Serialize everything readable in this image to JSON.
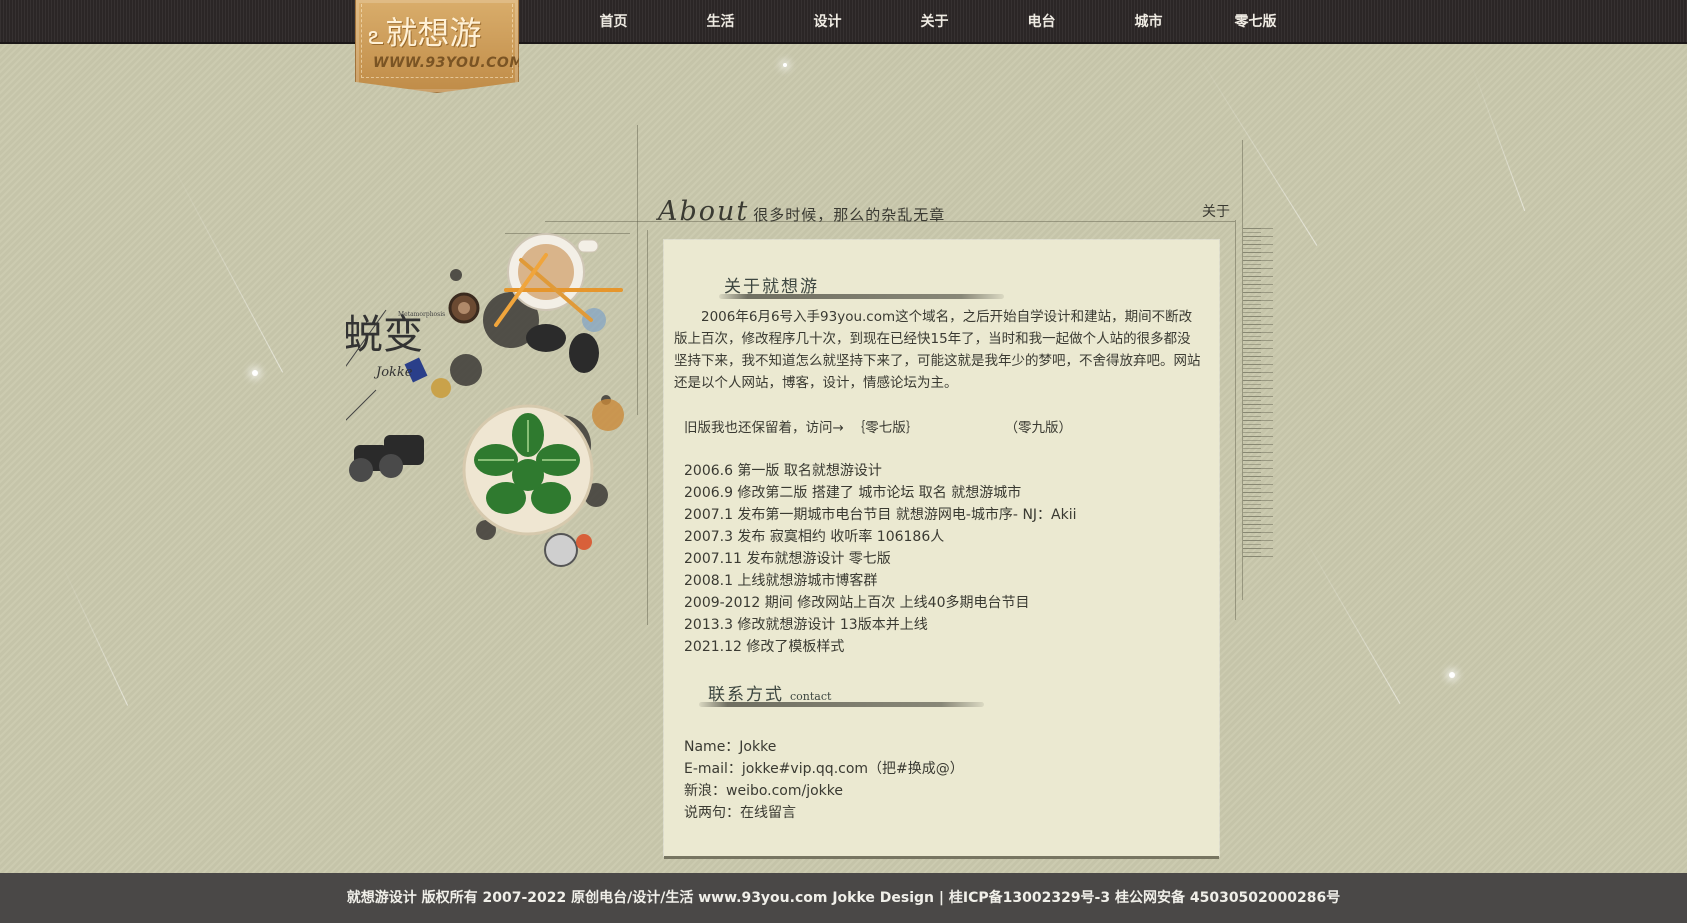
{
  "logo": {
    "name": "就想游",
    "url": "WWW.93YOU.COM"
  },
  "nav": [
    "首页",
    "生活",
    "设计",
    "关于",
    "电台",
    "城市",
    "零七版"
  ],
  "about_header": {
    "title": "About",
    "subtitle": "很多时候，那么的杂乱无章",
    "right_label": "关于"
  },
  "art": {
    "title": "蜕变",
    "subtitle": "Metamorphosis",
    "signature": "Jokke"
  },
  "intro": {
    "title": "关于就想游",
    "paragraph": "2006年6月6号入手93you.com这个域名，之后开始自学设计和建站，期间不断改版上百次，修改程序几十次，到现在已经快15年了，当时和我一起做个人站的很多都没坚持下来，我不知道怎么就坚持下来了，可能这就是我年少的梦吧，不舍得放弃吧。网站还是以个人网站，博客，设计，情感论坛为主。"
  },
  "versions": {
    "text": "旧版我也还保留着，访问→",
    "v07": "｛零七版｝",
    "v09": "（零九版）"
  },
  "timeline": [
    "2006.6 第一版 取名就想游设计",
    "2006.9 修改第二版 搭建了 城市论坛 取名 就想游城市",
    "2007.1 发布第一期城市电台节目 就想游网电-城市序- NJ：Akii",
    "2007.3 发布 寂寞相约 收听率 106186人",
    "2007.11 发布就想游设计 零七版",
    "2008.1 上线就想游城市博客群",
    "2009-2012 期间 修改网站上百次 上线40多期电台节目",
    "2013.3 修改就想游设计 13版本并上线",
    "2021.12 修改了模板样式"
  ],
  "contact": {
    "title": "联系方式",
    "subtitle": "contact",
    "name": "Name：Jokke",
    "email": "E-mail：jokke#vip.qq.com（把#换成@）",
    "weibo": "新浪：weibo.com/jokke",
    "message_prefix": "说两句：",
    "message_link": "在线留言"
  },
  "footer": "就想游设计 版权所有 2007-2022 原创电台/设计/生活 www.93you.com Jokke Design |     桂ICP备13002329号-3 桂公网安备 45030502000286号",
  "colors": {
    "background": "#c9c8ac",
    "topbar": "#2b2626",
    "panel": "#ebe9d1",
    "footer": "#4a4847",
    "logo": "#c99a55"
  }
}
